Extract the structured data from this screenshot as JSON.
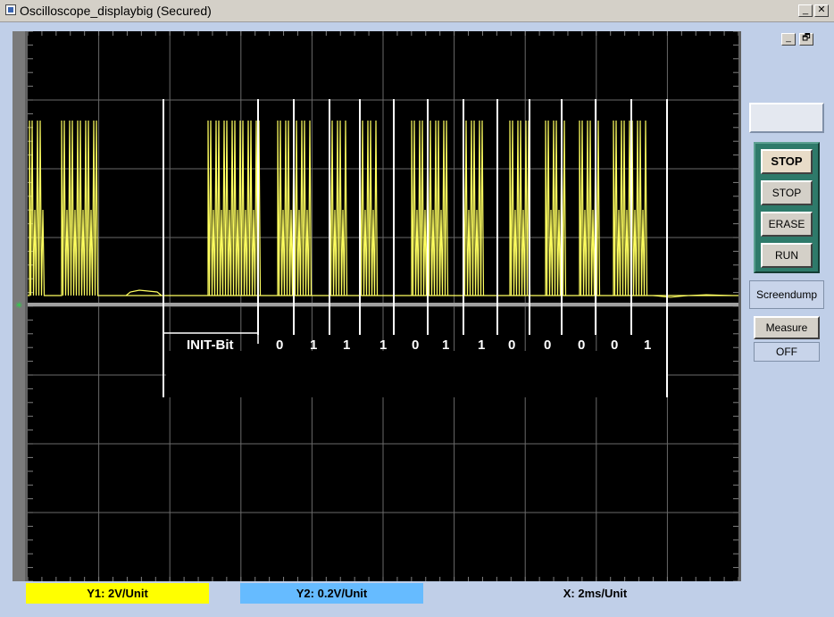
{
  "window": {
    "title": "Oscilloscope_displaybig (Secured)",
    "minimize": "_",
    "close": "✕"
  },
  "inner_controls": {
    "minimize": "_",
    "restore": "🗗"
  },
  "annotations": {
    "init_label": "INIT-Bit",
    "bits": [
      "0",
      "1",
      "1",
      "1",
      "0",
      "1",
      "1",
      "0",
      "0",
      "0",
      "0",
      "1"
    ]
  },
  "buttons": {
    "stop_active": "STOP",
    "stop": "STOP",
    "erase": "ERASE",
    "run": "RUN",
    "screendump": "Screendump",
    "measure": "Measure",
    "measure_state": "OFF"
  },
  "status": {
    "y1": "Y1: 2V/Unit",
    "y2": "Y2: 0.2V/Unit",
    "x": "X: 2ms/Unit"
  },
  "colors": {
    "trace": "#ffff60",
    "y1_bg": "#ffff00",
    "y2_bg": "#66bbff",
    "screen": "#000000",
    "grid": "#808080",
    "panel": "#2e7a6a"
  },
  "icons": {
    "trigger_marker": "trigger-marker-icon",
    "app": "app-icon"
  }
}
